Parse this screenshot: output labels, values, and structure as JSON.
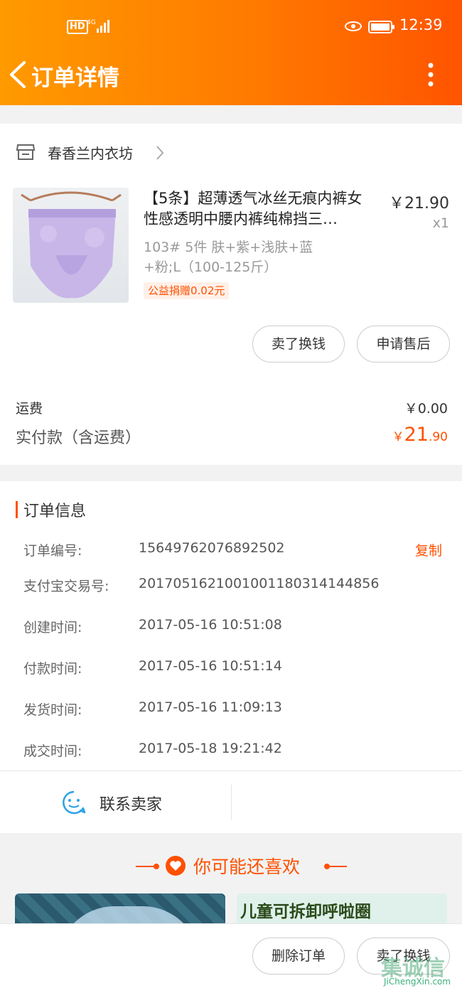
{
  "status_bar": {
    "network": "HD",
    "signal": "4G",
    "time": "12:39"
  },
  "nav": {
    "title": "订单详情"
  },
  "shop": {
    "name": "春香兰内衣坊"
  },
  "product": {
    "title": "【5条】超薄透气冰丝无痕内裤女性感透明中腰内裤纯棉挡三…",
    "price": "￥21.90",
    "qty": "x1",
    "sku": "103# 5件 肤+紫+浅肤+蓝+粉;L（100-125斤）",
    "donate": "公益捐赠0.02元"
  },
  "actions": {
    "sell_label": "卖了换钱",
    "after_sale_label": "申请售后"
  },
  "fees": {
    "shipping_label": "运费",
    "shipping_value": "￥0.00",
    "paid_label": "实付款（含运费）",
    "paid_symbol": "￥",
    "paid_int": "21",
    "paid_dec": ".90"
  },
  "order_info": {
    "title": "订单信息",
    "copy_label": "复制",
    "rows": [
      {
        "k": "订单编号:",
        "v": "15649762076892502"
      },
      {
        "k": "支付宝交易号:",
        "v": "2017051621001001180314144856"
      },
      {
        "k": "创建时间:",
        "v": "2017-05-16 10:51:08"
      },
      {
        "k": "付款时间:",
        "v": "2017-05-16 10:51:14"
      },
      {
        "k": "发货时间:",
        "v": "2017-05-16 11:09:13"
      },
      {
        "k": "成交时间:",
        "v": "2017-05-18 19:21:42"
      }
    ]
  },
  "contact": {
    "label": "联系卖家"
  },
  "recommend": {
    "title": "你可能还喜欢",
    "item2_text": "儿童可拆卸呼啦圈"
  },
  "bottom_bar": {
    "delete_label": "删除订单",
    "sell_label": "卖了换钱"
  },
  "watermark": {
    "text": "JiChengXin.com",
    "logo_text": "集诚信"
  },
  "colors": {
    "brand_orange": "#ff5000",
    "topbar_start": "#ff9a00",
    "topbar_end": "#ff5400"
  }
}
